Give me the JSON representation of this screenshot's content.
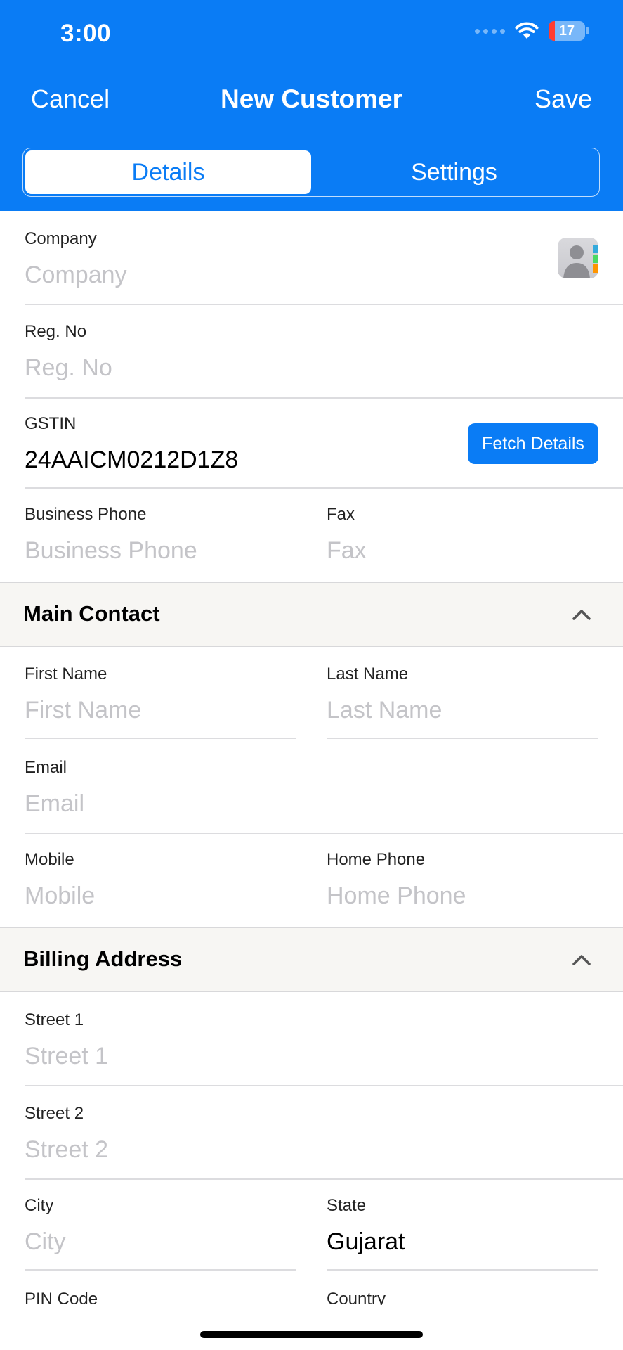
{
  "status_bar": {
    "time": "3:00",
    "battery": "17",
    "battery_level": 0.17,
    "icons": [
      "cellular-dots-icon",
      "wifi-icon",
      "battery-charging-icon"
    ]
  },
  "nav": {
    "cancel": "Cancel",
    "title": "New Customer",
    "save": "Save"
  },
  "tabs": [
    {
      "label": "Details",
      "active": true
    },
    {
      "label": "Settings",
      "active": false
    }
  ],
  "company_info": {
    "company": {
      "label": "Company",
      "placeholder": "Company"
    },
    "reg_no": {
      "label": "Reg. No",
      "placeholder": "Reg. No"
    },
    "gstin": {
      "label": "GSTIN",
      "value": "24AAICM0212D1Z8"
    },
    "fetch_button": "Fetch Details",
    "business_phone": {
      "label": "Business Phone",
      "placeholder": "Business Phone"
    },
    "fax": {
      "label": "Fax",
      "placeholder": "Fax"
    }
  },
  "main_contact": {
    "title": "Main Contact",
    "first_name": {
      "label": "First Name",
      "placeholder": "First Name"
    },
    "last_name": {
      "label": "Last Name",
      "placeholder": "Last Name"
    },
    "email": {
      "label": "Email",
      "placeholder": "Email"
    },
    "mobile": {
      "label": "Mobile",
      "placeholder": "Mobile"
    },
    "home_phone": {
      "label": "Home Phone",
      "placeholder": "Home Phone"
    }
  },
  "billing_address": {
    "title": "Billing Address",
    "street1": {
      "label": "Street 1",
      "placeholder": "Street 1"
    },
    "street2": {
      "label": "Street 2",
      "placeholder": "Street 2"
    },
    "city": {
      "label": "City",
      "placeholder": "City"
    },
    "state": {
      "label": "State",
      "value": "Gujarat"
    },
    "pin_code": {
      "label": "PIN Code"
    },
    "country": {
      "label": "Country"
    }
  },
  "colors": {
    "accent": "#0a7cf5",
    "section_bg": "#f7f6f3",
    "placeholder": "#c4c4c8"
  }
}
